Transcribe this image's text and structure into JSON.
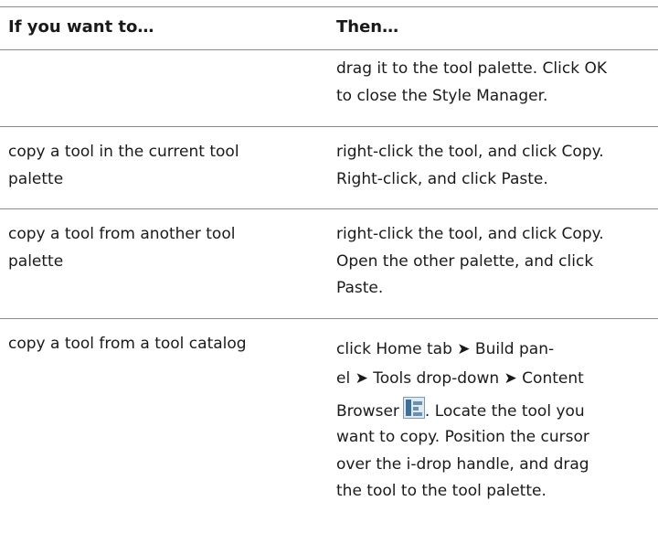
{
  "header": {
    "col1": "If you want to…",
    "col2": "Then…"
  },
  "rows": [
    {
      "action": "",
      "result_lines": [
        "drag it to the tool palette. Click OK",
        "to close the Style Manager."
      ]
    },
    {
      "action_lines": [
        "copy a tool in the current tool",
        "palette"
      ],
      "result_lines": [
        "right-click the tool, and click Copy.",
        "Right-click, and click Paste."
      ]
    },
    {
      "action_lines": [
        "copy a tool from another tool",
        "palette"
      ],
      "result_lines": [
        "right-click the tool, and click Copy.",
        "Open the other palette, and click",
        "Paste."
      ]
    },
    {
      "action_lines": [
        "copy a tool from a tool catalog"
      ],
      "result_lines": [
        "click Home tab ➤ Build pan-",
        "el ➤ Tools drop-down ➤ Content",
        "Browser",
        ". Locate the tool you",
        "want to copy. Position the cursor",
        "over the i-drop handle, and drag",
        "the tool to the tool palette."
      ]
    }
  ],
  "icons": {
    "content_browser": "content-browser-icon"
  }
}
